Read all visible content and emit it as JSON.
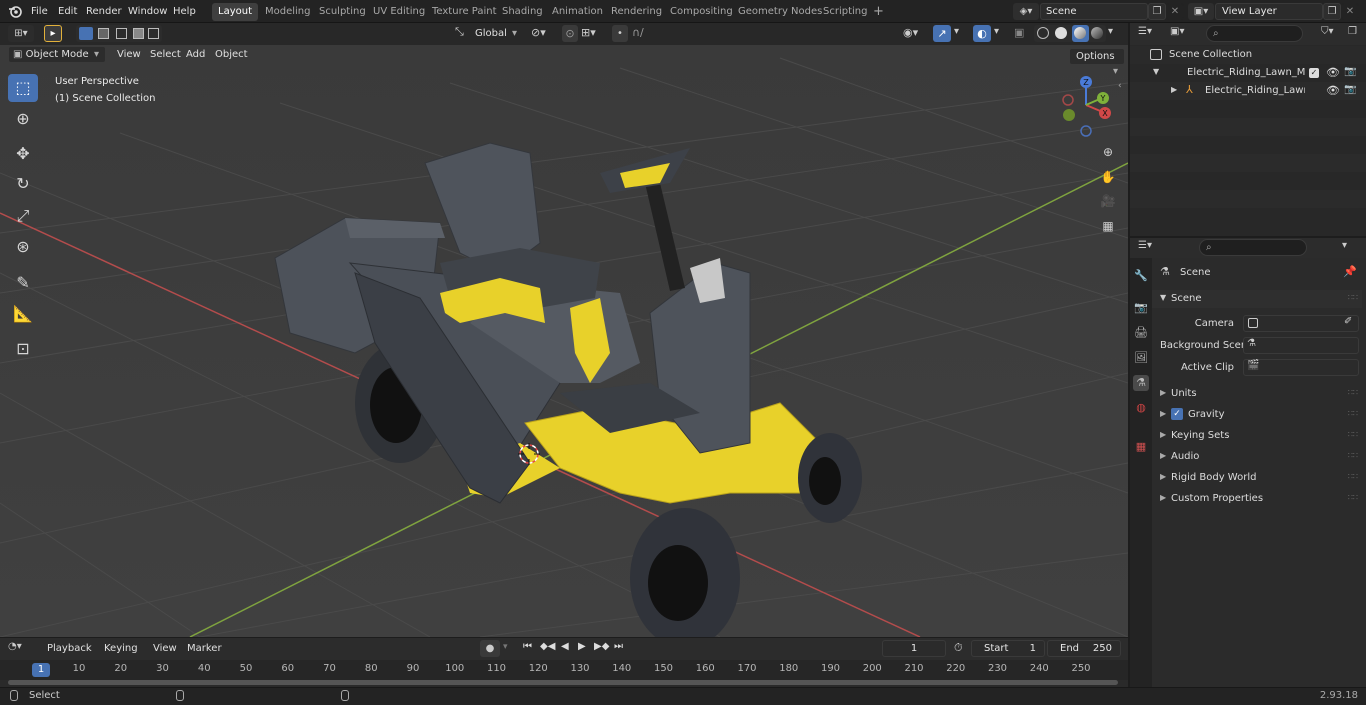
{
  "menubar": {
    "items": [
      "File",
      "Edit",
      "Render",
      "Window",
      "Help"
    ],
    "workspaces": [
      "Layout",
      "Modeling",
      "Sculpting",
      "UV Editing",
      "Texture Paint",
      "Shading",
      "Animation",
      "Rendering",
      "Compositing",
      "Geometry Nodes",
      "Scripting"
    ],
    "add_workspace": "+",
    "scene_name": "Scene",
    "view_layer_name": "View Layer"
  },
  "viewport_header": {
    "mode": "Object Mode",
    "view": "View",
    "select": "Select",
    "add": "Add",
    "object": "Object",
    "transform_orientation": "Global",
    "options": "Options"
  },
  "viewport": {
    "perspective_label": "User Perspective",
    "collection_label": "(1) Scene Collection",
    "gizmo": {
      "x": "X",
      "y": "Y",
      "z": "Z"
    }
  },
  "outliner": {
    "root": "Scene Collection",
    "items": [
      {
        "label": "Electric_Riding_Lawn_Mower_"
      },
      {
        "label": "Electric_Riding_Lawn_Mo"
      }
    ]
  },
  "properties": {
    "context": "Scene",
    "panel_title": "Scene",
    "fields": [
      {
        "label": "Camera",
        "value": ""
      },
      {
        "label": "Background Scene",
        "value": ""
      },
      {
        "label": "Active Clip",
        "value": ""
      }
    ],
    "sections": [
      "Units",
      "Gravity",
      "Keying Sets",
      "Audio",
      "Rigid Body World",
      "Custom Properties"
    ],
    "gravity_enabled": true
  },
  "timeline": {
    "menus": [
      "Playback",
      "Keying",
      "View",
      "Marker"
    ],
    "current_frame": "1",
    "start_label": "Start",
    "start_value": "1",
    "end_label": "End",
    "end_value": "250",
    "ruler": [
      "10",
      "20",
      "30",
      "40",
      "50",
      "60",
      "70",
      "80",
      "90",
      "100",
      "110",
      "120",
      "130",
      "140",
      "150",
      "160",
      "170",
      "180",
      "190",
      "200",
      "210",
      "220",
      "230",
      "240",
      "250"
    ],
    "ruler_current": "1"
  },
  "statusbar": {
    "select_label": "Select",
    "version": "2.93.18"
  },
  "colors": {
    "accent": "#4772b3",
    "mower_yellow": "#e8d12a",
    "axis_x": "#b34c4c",
    "axis_y": "#7fa33f"
  }
}
